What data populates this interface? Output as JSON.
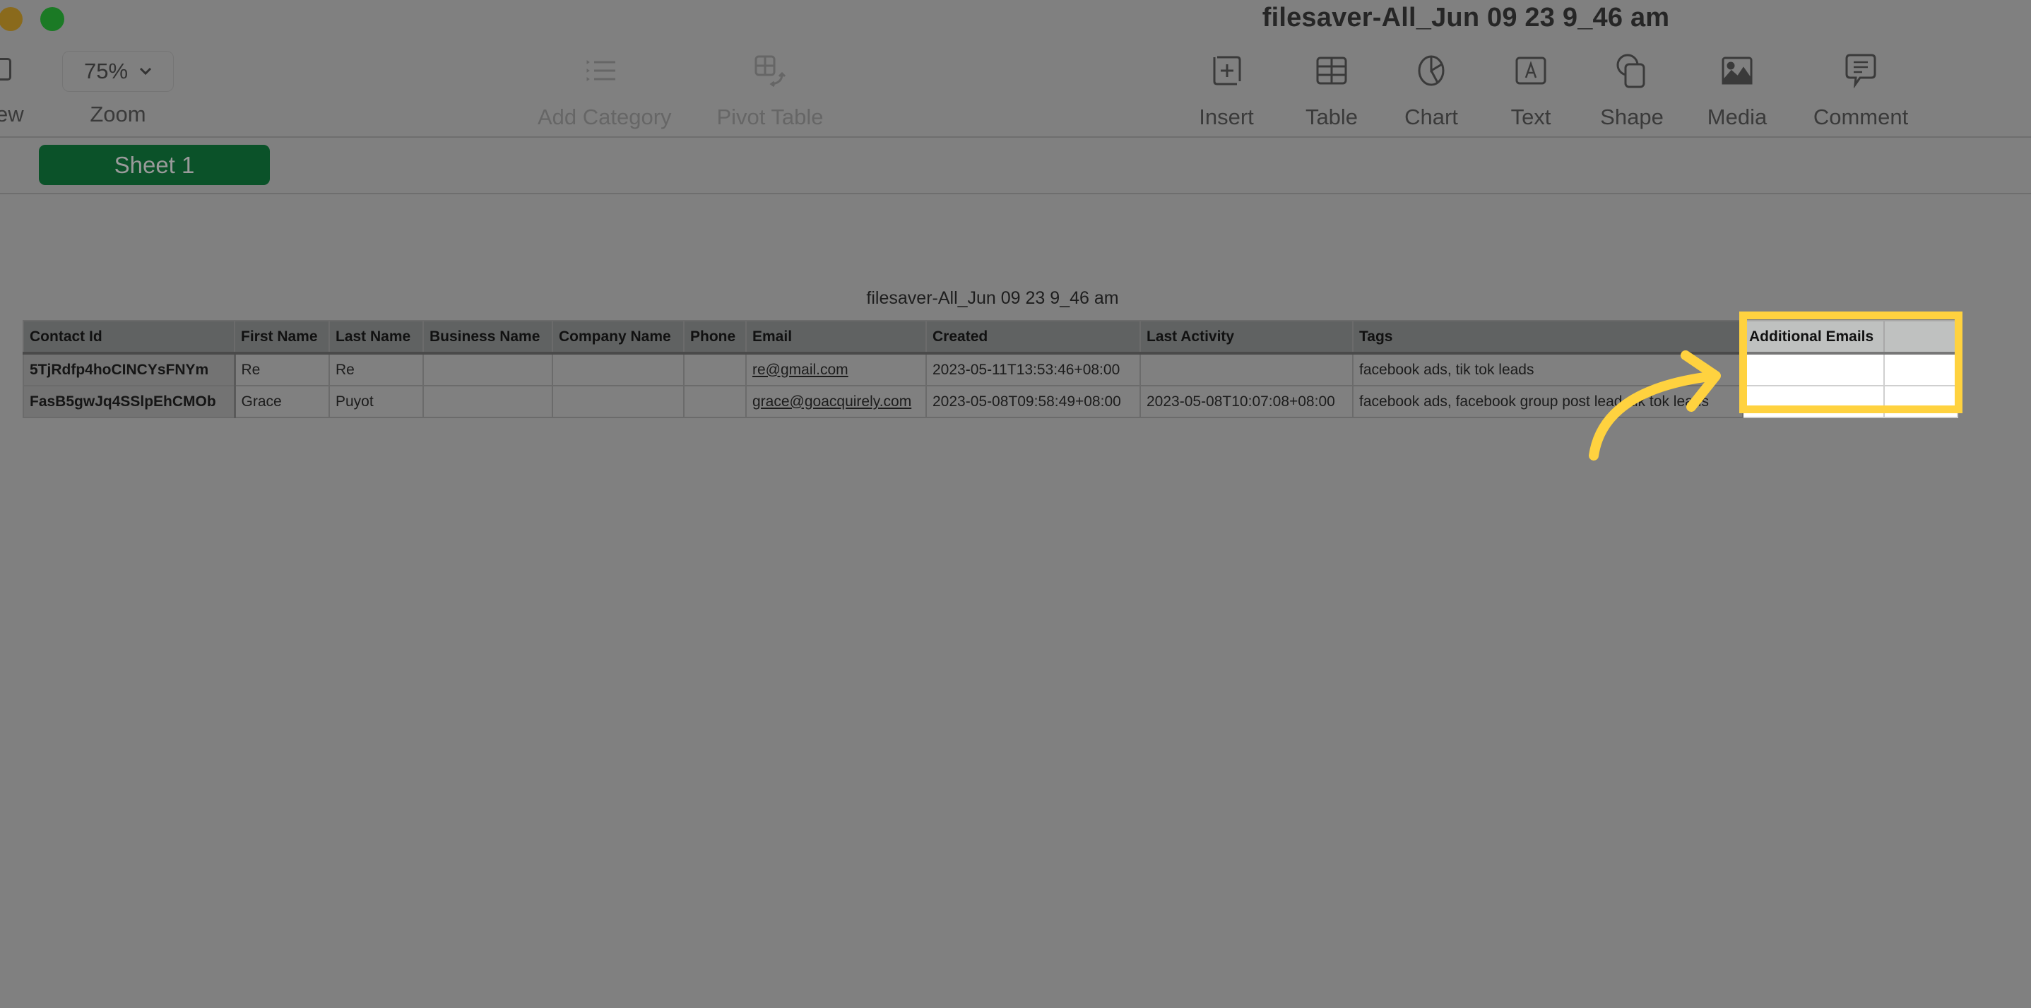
{
  "window": {
    "title": "filesaver-All_Jun 09 23 9_46 am",
    "controls": [
      "minimize",
      "zoom"
    ]
  },
  "toolbar": {
    "view_label_partial": "ew",
    "zoom": {
      "value": "75%",
      "label": "Zoom"
    },
    "items": [
      {
        "label": "Add Category",
        "icon": "list-icon",
        "enabled": false
      },
      {
        "label": "Pivot Table",
        "icon": "pivot-table-icon",
        "enabled": false
      },
      {
        "label": "Insert",
        "icon": "insert-icon",
        "enabled": true
      },
      {
        "label": "Table",
        "icon": "table-icon",
        "enabled": true
      },
      {
        "label": "Chart",
        "icon": "chart-icon",
        "enabled": true
      },
      {
        "label": "Text",
        "icon": "text-box-icon",
        "enabled": true
      },
      {
        "label": "Shape",
        "icon": "shape-icon",
        "enabled": true
      },
      {
        "label": "Media",
        "icon": "media-icon",
        "enabled": true
      },
      {
        "label": "Comment",
        "icon": "comment-icon",
        "enabled": true
      }
    ]
  },
  "sheets": [
    {
      "label": "Sheet 1",
      "active": true
    }
  ],
  "table": {
    "caption": "filesaver-All_Jun 09 23 9_46 am",
    "columns": [
      "Contact Id",
      "First Name",
      "Last Name",
      "Business Name",
      "Company Name",
      "Phone",
      "Email",
      "Created",
      "Last Activity",
      "Tags",
      "Additional Emails",
      ""
    ],
    "rows": [
      [
        "5TjRdfp4hoCINCYsFNYm",
        "Re",
        "Re",
        "",
        "",
        "",
        "re@gmail.com",
        "2023-05-11T13:53:46+08:00",
        "",
        "facebook ads, tik tok leads",
        "",
        ""
      ],
      [
        "FasB5gwJq4SSlpEhCMOb",
        "Grace",
        "Puyot",
        "",
        "",
        "",
        "grace@goacquirely.com",
        "2023-05-08T09:58:49+08:00",
        "2023-05-08T10:07:08+08:00",
        "facebook ads, facebook group post lead, tik tok leads",
        "",
        ""
      ]
    ]
  },
  "annotation": {
    "highlight_color": "#ffd23f",
    "highlighted_column": "Additional Emails"
  },
  "colors": {
    "overlay_bg": "#808080",
    "sheet_tab": "#0b5229"
  }
}
